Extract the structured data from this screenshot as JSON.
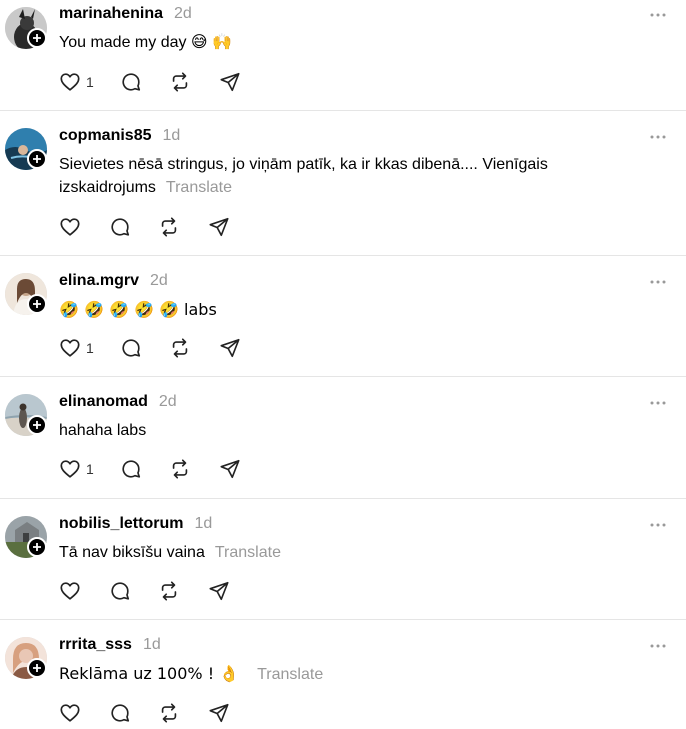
{
  "comments": [
    {
      "username": "marinahenina",
      "time": "2d",
      "text": "You made my day 😅 🙌",
      "translate": "",
      "likes": "1",
      "avatar_colors": [
        "#c9c9c9",
        "#2a2a2a"
      ]
    },
    {
      "username": "copmanis85",
      "time": "1d",
      "text": "Sievietes nēsā stringus, jo viņām patīk, ka ir kkas dibenā.... Vienīgais izskaidrojums",
      "translate": "Translate",
      "likes": "",
      "avatar_colors": [
        "#2f7fae",
        "#163a52"
      ]
    },
    {
      "username": "elina.mgrv",
      "time": "2d",
      "text": "🤣 🤣 🤣 🤣 🤣 labs",
      "translate": "",
      "likes": "1",
      "avatar_colors": [
        "#efe6dc",
        "#c7a68b"
      ]
    },
    {
      "username": "elinanomad",
      "time": "2d",
      "text": "hahaha labs",
      "translate": "",
      "likes": "1",
      "avatar_colors": [
        "#b9c7cf",
        "#5d5650"
      ]
    },
    {
      "username": "nobilis_lettorum",
      "time": "1d",
      "text": "Tā nav biksīšu vaina",
      "translate": "Translate",
      "likes": "",
      "avatar_colors": [
        "#9aa3a8",
        "#5a6f3f"
      ]
    },
    {
      "username": "rrrita_sss",
      "time": "1d",
      "text": "Reklāma uz 100% ! 👌",
      "translate": "Translate",
      "likes": "",
      "avatar_colors": [
        "#e9c7b5",
        "#8a5a44"
      ]
    }
  ],
  "icons": {
    "like": "heart-icon",
    "reply": "comment-icon",
    "repost": "repost-icon",
    "share": "send-icon",
    "more": "more-dots-icon",
    "follow": "plus-icon"
  }
}
